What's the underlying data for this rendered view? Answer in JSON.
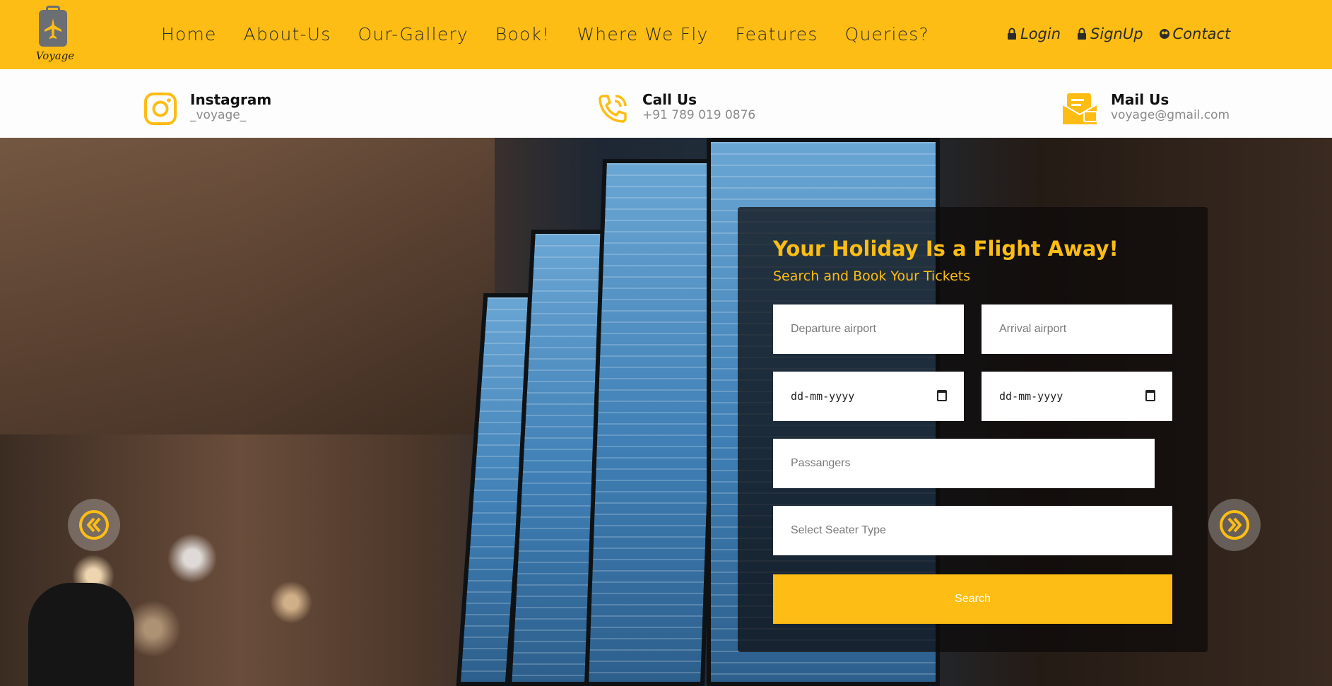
{
  "brand": {
    "name": "Voyage"
  },
  "nav": {
    "items": [
      "Home",
      "About-Us",
      "Our-Gallery",
      "Book!",
      "Where We Fly",
      "Features",
      "Queries?"
    ]
  },
  "auth": {
    "login": "Login",
    "signup": "SignUp",
    "contact": "Contact"
  },
  "contacts": {
    "instagram": {
      "title": "Instagram",
      "value": "_voyage_"
    },
    "call": {
      "title": "Call Us",
      "value": "+91 789 019 0876"
    },
    "mail": {
      "title": "Mail Us",
      "value": "voyage@gmail.com"
    }
  },
  "booking": {
    "title": "Your Holiday Is a Flight Away!",
    "subtitle": "Search and Book Your Tickets",
    "departure_placeholder": "Departure airport",
    "arrival_placeholder": "Arrival airport",
    "date_placeholder_1": "dd-mm-yyyy",
    "date_placeholder_2": "dd-mm-yyyy",
    "passengers_placeholder": "Passangers",
    "seater_placeholder": "Select Seater Type",
    "search_label": "Search"
  },
  "colors": {
    "accent": "#fdbd14",
    "text_dark": "#2b2b2b",
    "muted": "#8a8a8a"
  }
}
